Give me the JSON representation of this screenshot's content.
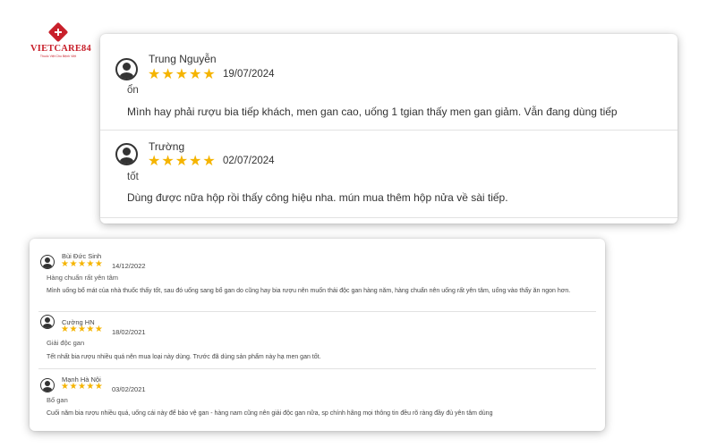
{
  "logo": {
    "name": "VIETCARE84",
    "tagline": "Thuốc Việt Cho Bệnh Việt",
    "color": "#c8202b"
  },
  "star_color": "#f5b400",
  "top_reviews": [
    {
      "author": "Trung Nguyễn",
      "rating": 5,
      "date": "19/07/2024",
      "title": "ổn",
      "text": "Mình hay phải rượu bia tiếp khách, men gan cao, uống 1 tgian thấy men gan giảm. Vẫn đang dùng tiếp"
    },
    {
      "author": "Trường",
      "rating": 5,
      "date": "02/07/2024",
      "title": "tốt",
      "text": "Dùng được nữa hộp rồi thấy công hiệu nha. mún mua thêm hộp nửa về sài tiếp."
    }
  ],
  "bottom_reviews": [
    {
      "author": "Bùi Đức Sinh",
      "rating": 5,
      "date": "14/12/2022",
      "title": "Hàng chuẩn rất yên tâm",
      "text": "Mình uống bổ mát của nhà thuốc thấy tốt, sau đó uống sang bổ gan do cũng hay bia rượu nên muốn thải độc gan hàng năm, hàng chuẩn nên uống rất yên tâm, uống vào thấy ăn ngon hơn."
    },
    {
      "author": "Cường HN",
      "rating": 5,
      "date": "18/02/2021",
      "title": "Giải độc gan",
      "text": "Tết nhất bia rượu nhiều quá nên mua loại này dùng. Trước đã dùng sản phẩm này hạ men gan tốt."
    },
    {
      "author": "Mạnh Hà Nội",
      "rating": 5,
      "date": "03/02/2021",
      "title": "Bổ gan",
      "text": "Cuối năm bia rượu nhiều quá, uống cái này để bảo vệ gan - hàng nam cũng nên giải độc gan nữa, sp chính hãng mọi thông tin đều rõ ràng đầy đủ yên tâm dùng"
    }
  ]
}
